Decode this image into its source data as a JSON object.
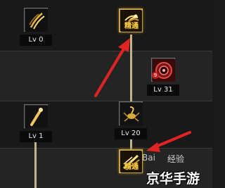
{
  "skills": [
    {
      "id": "s1",
      "level": "Lv 0",
      "icon": "claw-slash-icon"
    },
    {
      "id": "s2",
      "tag": "精通",
      "icon": "spiral-strike-icon"
    },
    {
      "id": "s3",
      "level": "Lv 31",
      "icon": "red-rune-circle-icon",
      "badge": "9"
    },
    {
      "id": "s4",
      "level": "Lv 1",
      "icon": "club-icon"
    },
    {
      "id": "s5",
      "level": "Lv 20",
      "icon": "scorpion-icon"
    },
    {
      "id": "s6",
      "tag": "精通",
      "icon": "dash-strike-icon"
    }
  ],
  "watermark": {
    "logo": "Bai",
    "text": "经验",
    "brand": "京华手游"
  },
  "colors": {
    "arrow": "#e02424",
    "connector": "#c2b48a",
    "gold_frame": "#c8a245",
    "mastery_text": "#ffd34a"
  }
}
